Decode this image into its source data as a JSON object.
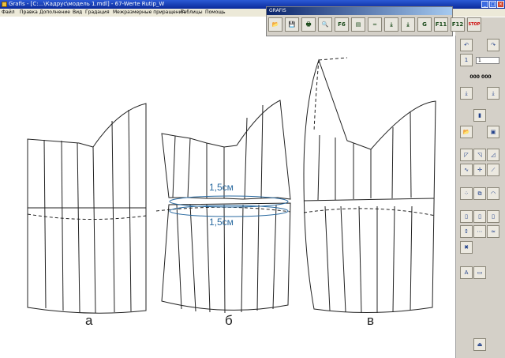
{
  "window": {
    "title": "Grafis - [C:...\\Кадрус\\модель 1.mdl] - 67-Werte Rutip_W"
  },
  "menu": [
    "Файл",
    "Правка",
    "Дополнение",
    "Вид",
    "Градация",
    "Межразмерные приращения",
    "Таблицы",
    "Помощь"
  ],
  "toolbar": {
    "title": "GRAFIS",
    "buttons": [
      {
        "name": "open-folder-icon",
        "glyph": "📂"
      },
      {
        "name": "save-icon",
        "glyph": "💾"
      },
      {
        "name": "print-icon",
        "glyph": "🖶"
      },
      {
        "name": "zoom-icon",
        "glyph": "🔍"
      },
      {
        "name": "f6-icon",
        "glyph": "F6"
      },
      {
        "name": "edit-page-icon",
        "glyph": "▤"
      },
      {
        "name": "measure-icon",
        "glyph": "═"
      },
      {
        "name": "download-icon",
        "glyph": "⤓"
      },
      {
        "name": "download-stack-icon",
        "glyph": "⤓"
      },
      {
        "name": "g-icon",
        "glyph": "G"
      },
      {
        "name": "f11-icon",
        "glyph": "F11"
      },
      {
        "name": "f12-icon",
        "glyph": "F12"
      },
      {
        "name": "stop-icon",
        "glyph": "STOP"
      }
    ]
  },
  "panel": {
    "coord_display": "000 000",
    "spin_value": "1"
  },
  "canvas": {
    "labels": [
      "а",
      "б",
      "в"
    ],
    "annotations": [
      "1,5см",
      "1,5см"
    ]
  },
  "colors": {
    "accent": "#2a6aa0",
    "line": "#222222"
  }
}
